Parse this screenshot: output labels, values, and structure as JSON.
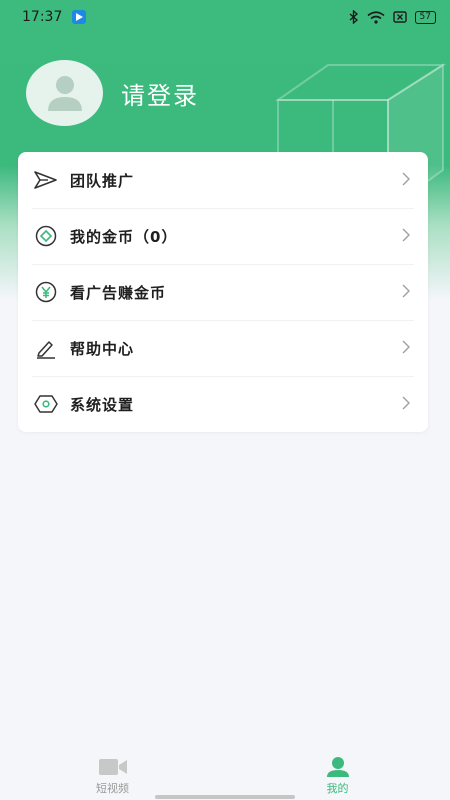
{
  "status_bar": {
    "time": "17:37",
    "battery": "57"
  },
  "profile": {
    "login_label": "请登录"
  },
  "menu": {
    "items": [
      {
        "label": "团队推广",
        "icon": "paper-plane-icon"
      },
      {
        "label": "我的金币（0）",
        "icon": "coin-icon"
      },
      {
        "label": "看广告赚金币",
        "icon": "yuan-coin-icon"
      },
      {
        "label": "帮助中心",
        "icon": "pen-icon"
      },
      {
        "label": "系统设置",
        "icon": "hexagon-settings-icon"
      }
    ]
  },
  "tabbar": {
    "tabs": [
      {
        "label": "短视频",
        "icon": "video-camera-icon",
        "active": false
      },
      {
        "label": "我的",
        "icon": "person-icon",
        "active": true
      }
    ]
  },
  "colors": {
    "brand_green": "#3cb97d",
    "inactive_gray": "#9a9a9a"
  }
}
